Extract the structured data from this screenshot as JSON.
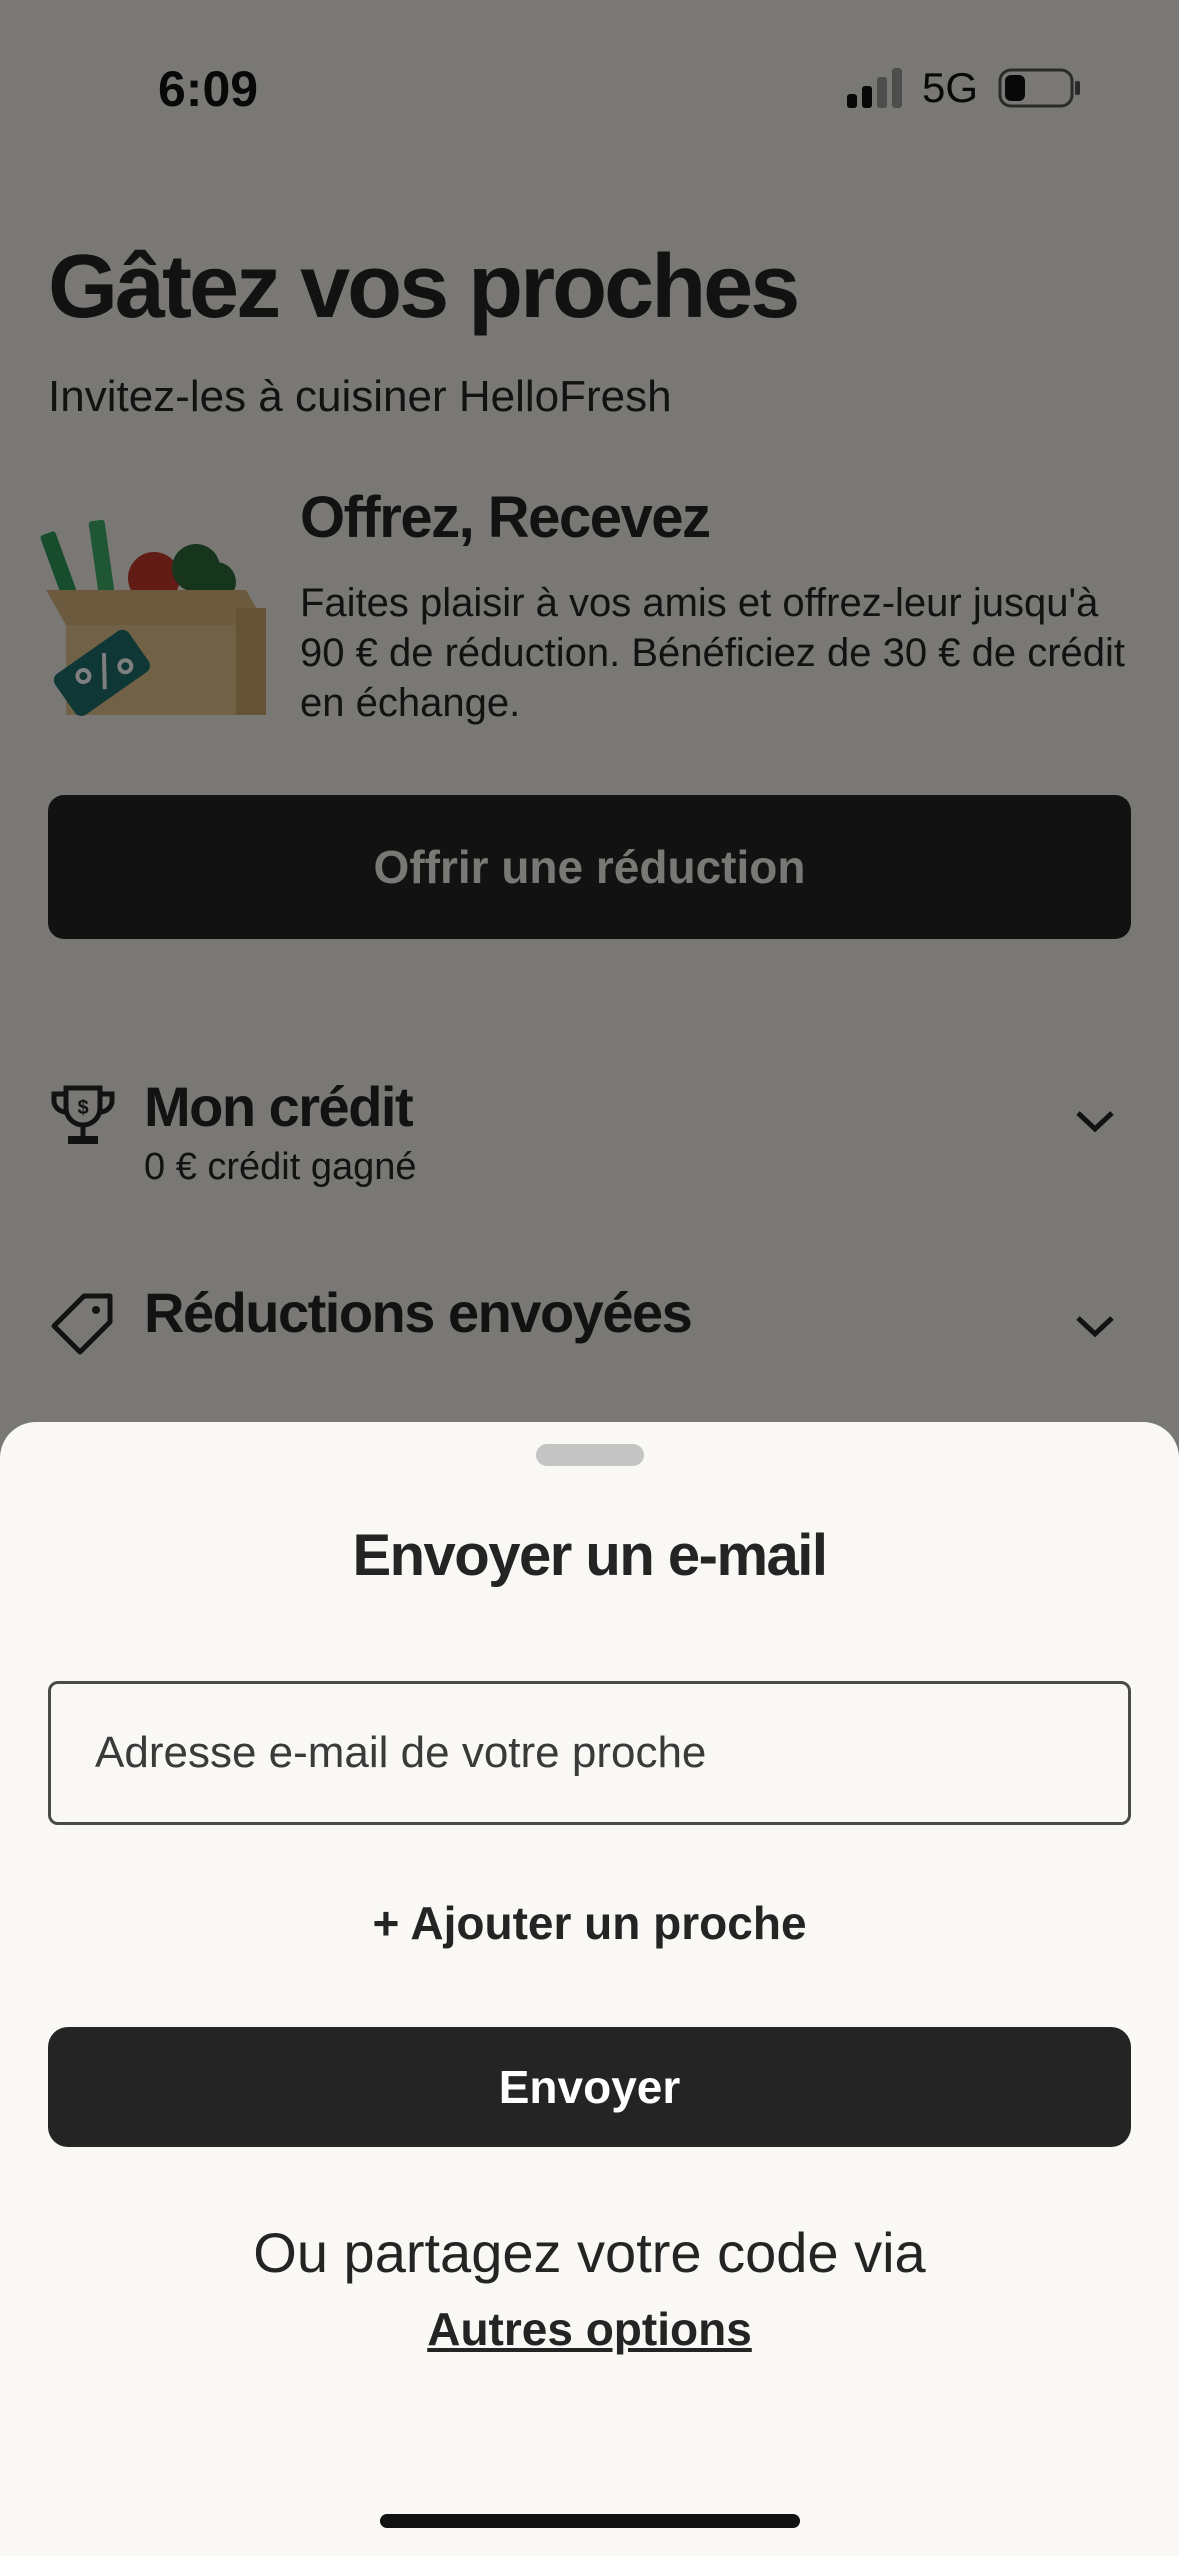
{
  "status_bar": {
    "time": "6:09",
    "network": "5G",
    "signal_icon": "signal-bars-icon",
    "battery_icon": "battery-low-icon"
  },
  "header": {
    "title": "Gâtez vos proches",
    "subtitle": "Invitez-les à cuisiner HelloFresh"
  },
  "promo": {
    "illustration_icon": "gift-box-discount-icon",
    "title": "Offrez, Recevez",
    "description": "Faites plaisir à vos amis et offrez-leur jusqu'à 90 € de réduction. Bénéficiez de 30 € de crédit en échange."
  },
  "offer_button": {
    "label": "Offrir une réduction"
  },
  "sections": [
    {
      "icon": "trophy-icon",
      "title": "Mon crédit",
      "subtitle": "0 € crédit gagné"
    },
    {
      "icon": "tag-icon",
      "title": "Réductions envoyées"
    }
  ],
  "sheet": {
    "title": "Envoyer un e-mail",
    "email_input": {
      "placeholder": "Adresse e-mail de votre proche",
      "value": ""
    },
    "add_link": "+ Ajouter un proche",
    "send_button": "Envoyer",
    "share_text": "Ou partagez votre code via",
    "other_options_link": "Autres options"
  },
  "colors": {
    "background": "#f3f1ea",
    "sheet_background": "#f9f8f4",
    "primary_dark": "#242424",
    "overlay": "rgba(0,0,0,0.5)"
  }
}
